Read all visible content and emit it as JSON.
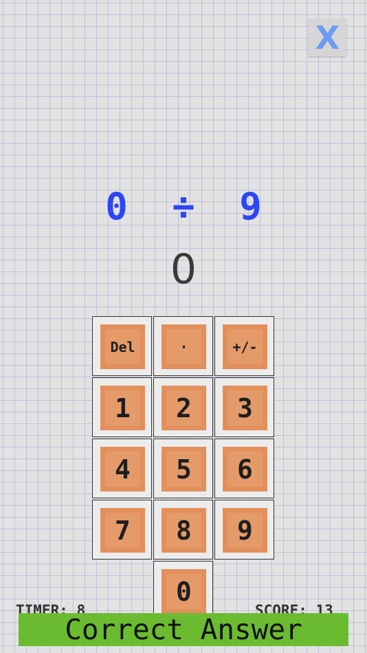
{
  "close_button": {
    "label": "X"
  },
  "equation": {
    "operand_a": "0",
    "operator": "÷",
    "operand_b": "9"
  },
  "answer": {
    "value": "0"
  },
  "keypad": {
    "del": "Del",
    "dot": "·",
    "sign": "+/-",
    "k1": "1",
    "k2": "2",
    "k3": "3",
    "k4": "4",
    "k5": "5",
    "k6": "6",
    "k7": "7",
    "k8": "8",
    "k9": "9",
    "k0": "0"
  },
  "status": {
    "timer": "TIMER: 8",
    "score": "SCORE: 13"
  },
  "feedback": {
    "message": "Correct Answer"
  },
  "colors": {
    "equation": "#2b47f5",
    "close": "#6d9bf1",
    "key_face": "#e49b69",
    "banner": "#6bbb30"
  }
}
